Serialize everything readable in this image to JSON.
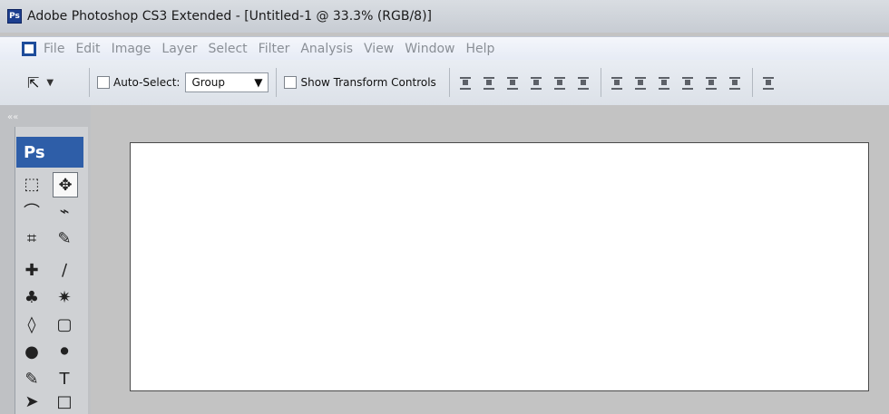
{
  "window": {
    "title": "Adobe Photoshop CS3 Extended - [Untitled-1 @ 33.3% (RGB/8)]",
    "app_badge": "Ps"
  },
  "menu": [
    "File",
    "Edit",
    "Image",
    "Layer",
    "Select",
    "Filter",
    "Analysis",
    "View",
    "Window",
    "Help"
  ],
  "options": {
    "auto_select_label": "Auto-Select:",
    "auto_select_value": "Group",
    "show_transform_label": "Show Transform Controls"
  },
  "toolbox": {
    "collapse_glyph": "««",
    "logo": "Ps",
    "tools": [
      [
        "⬚",
        "✥"
      ],
      [
        "⌒",
        "⌁"
      ],
      [
        "⌗",
        "✎"
      ],
      [
        "✚",
        "∕"
      ],
      [
        "♣",
        "✷"
      ],
      [
        "◊",
        "▢"
      ],
      [
        "●",
        "⚫"
      ],
      [
        "✎",
        "T"
      ],
      [
        "➤",
        "□"
      ]
    ]
  }
}
